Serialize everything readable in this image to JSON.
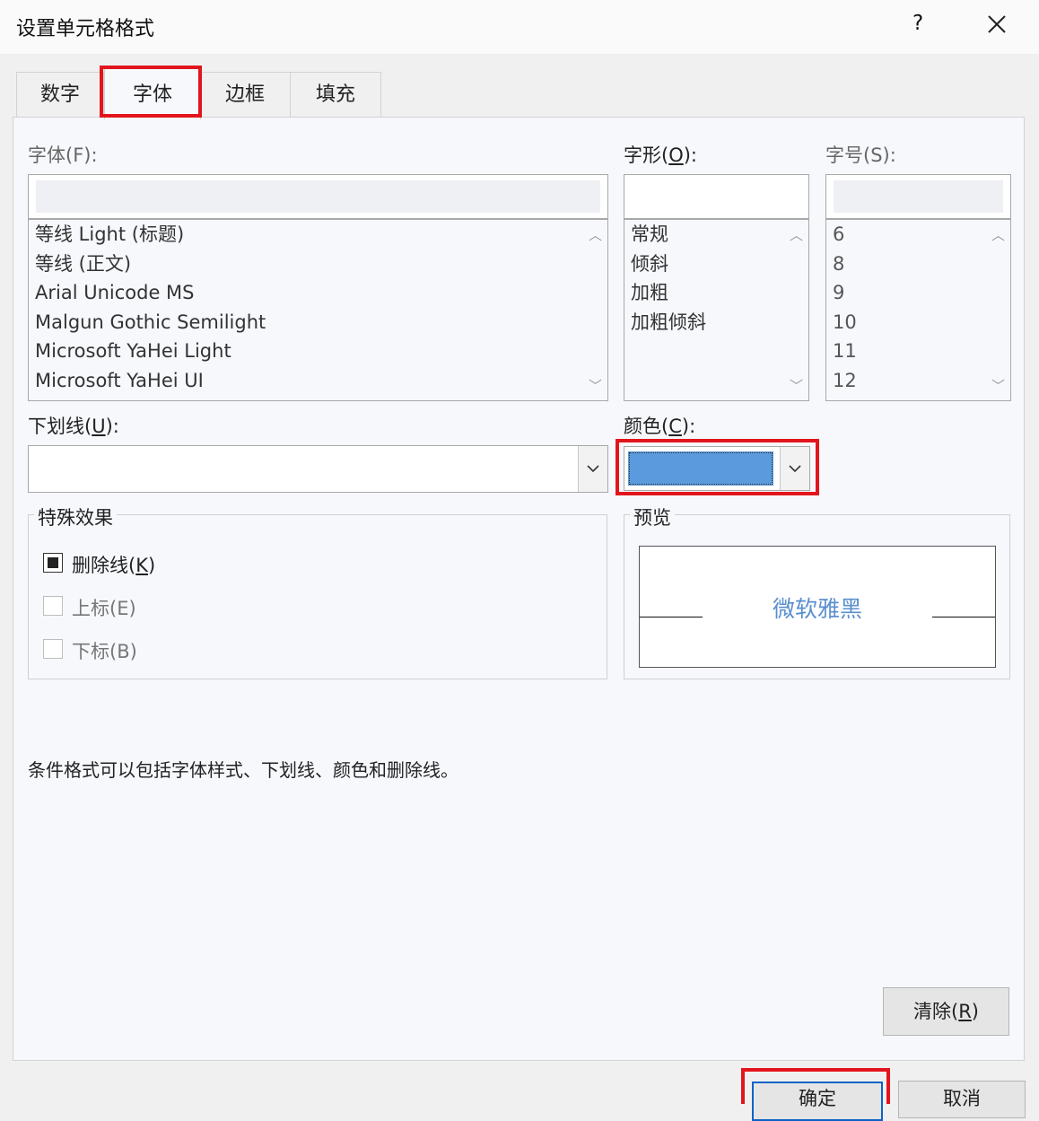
{
  "dialog": {
    "title": "设置单元格格式",
    "help_label": "?"
  },
  "tabs": [
    {
      "label": "数字"
    },
    {
      "label": "字体"
    },
    {
      "label": "边框"
    },
    {
      "label": "填充"
    }
  ],
  "active_tab": "字体",
  "font": {
    "label": "字体(F):",
    "value": "",
    "items": [
      "等线 Light (标题)",
      "等线 (正文)",
      "Arial Unicode MS",
      "Malgun Gothic Semilight",
      "Microsoft YaHei Light",
      "Microsoft YaHei UI"
    ]
  },
  "style": {
    "label_pre": "字形(",
    "label_key": "O",
    "label_post": "):",
    "value": "",
    "items": [
      "常规",
      "倾斜",
      "加粗",
      "加粗倾斜"
    ]
  },
  "size": {
    "label": "字号(S):",
    "value": "",
    "items": [
      "6",
      "8",
      "9",
      "10",
      "11",
      "12"
    ]
  },
  "underline": {
    "label_pre": "下划线(",
    "label_key": "U",
    "label_post": "):",
    "value": ""
  },
  "color": {
    "label_pre": "颜色(",
    "label_key": "C",
    "label_post": "):",
    "swatch": "#5b9bdd"
  },
  "effects": {
    "title": "特殊效果",
    "strikethrough": {
      "label_pre": "删除线(",
      "label_key": "K",
      "label_post": ")",
      "state": "indeterminate"
    },
    "superscript": {
      "label": "上标(E)",
      "enabled": false
    },
    "subscript": {
      "label": "下标(B)",
      "enabled": false
    }
  },
  "preview": {
    "title": "预览",
    "sample": "微软雅黑"
  },
  "note": "条件格式可以包括字体样式、下划线、颜色和删除线。",
  "buttons": {
    "clear_pre": "清除(",
    "clear_key": "R",
    "clear_post": ")",
    "ok": "确定",
    "cancel": "取消"
  },
  "highlight_color": "#e2151d"
}
